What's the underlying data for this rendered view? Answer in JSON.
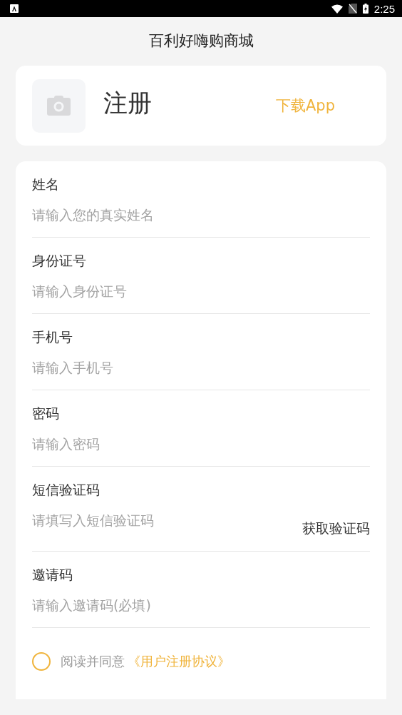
{
  "status_bar": {
    "time": "2:25"
  },
  "title": "百利好嗨购商城",
  "header": {
    "heading": "注册",
    "download_link": "下载App"
  },
  "fields": [
    {
      "kind": "plain",
      "label": "姓名",
      "placeholder": "请输入您的真实姓名"
    },
    {
      "kind": "plain",
      "label": "身份证号",
      "placeholder": "请输入身份证号"
    },
    {
      "kind": "plain",
      "label": "手机号",
      "placeholder": "请输入手机号"
    },
    {
      "kind": "plain",
      "label": "密码",
      "placeholder": "请输入密码"
    },
    {
      "kind": "code",
      "label": "短信验证码",
      "placeholder": "请填写入短信验证码",
      "action": "获取验证码"
    },
    {
      "kind": "plain",
      "label": "邀请码",
      "placeholder": "请输入邀请码(必填)"
    }
  ],
  "agreement": {
    "checked": false,
    "text": "阅读并同意",
    "link": "《用户注册协议》"
  }
}
